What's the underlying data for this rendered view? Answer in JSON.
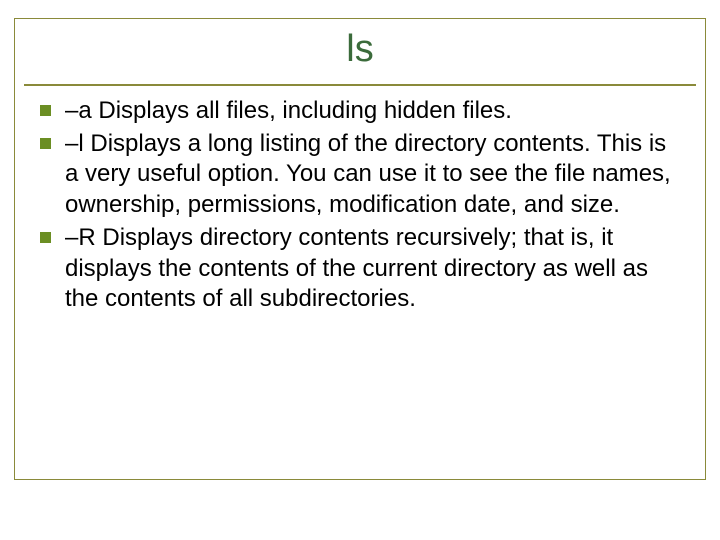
{
  "title": "ls",
  "bullets": [
    {
      "flag": "–a",
      "desc": " Displays all files, including hidden files."
    },
    {
      "flag": "–l",
      "desc": " Displays a long listing of the directory contents. This is a very useful option. You can use it to see the file names, ownership, permissions, modification date, and size."
    },
    {
      "flag": "–R",
      "desc": " Displays directory contents recursively; that is, it displays the contents of the current directory as well as the contents of all subdirectories."
    }
  ]
}
